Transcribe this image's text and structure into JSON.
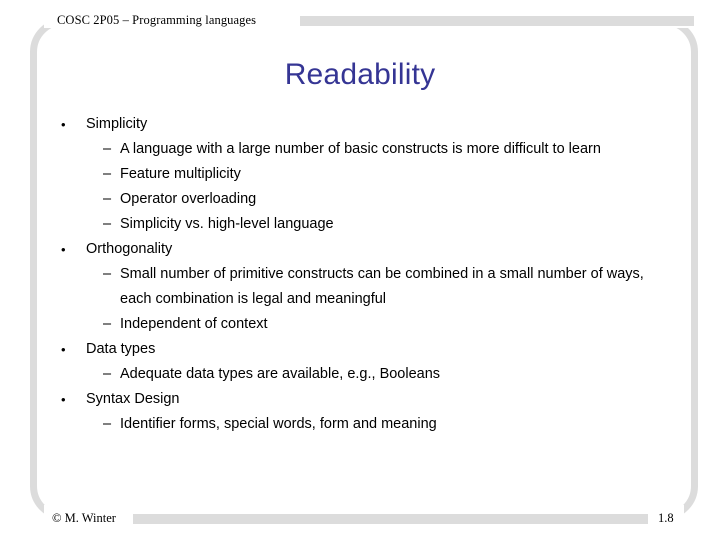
{
  "header": {
    "course_label": "COSC 2P05 – Programming languages",
    "bar_color": "#dcdcdc"
  },
  "title": {
    "text": "Readability",
    "color": "#353594"
  },
  "frame": {
    "color": "#dcdcdc"
  },
  "body": {
    "bullet_marker": "•",
    "subbullet_marker": "–",
    "items": [
      {
        "label": "Simplicity",
        "subitems": [
          "A language with a large number of basic constructs is more difficult to learn",
          "Feature multiplicity",
          "Operator overloading",
          "Simplicity vs. high-level language"
        ]
      },
      {
        "label": "Orthogonality",
        "subitems": [
          "Small number of primitive constructs can be combined in a small number of ways, each combination is legal and meaningful",
          "Independent of context"
        ]
      },
      {
        "label": "Data types",
        "subitems": [
          "Adequate data types are available, e.g., Booleans"
        ]
      },
      {
        "label": "Syntax Design",
        "subitems": [
          "Identifier forms, special words, form and meaning"
        ]
      }
    ]
  },
  "footer": {
    "copyright": "© M. Winter",
    "page_number": "1.8",
    "bar_color": "#dcdcdc"
  }
}
